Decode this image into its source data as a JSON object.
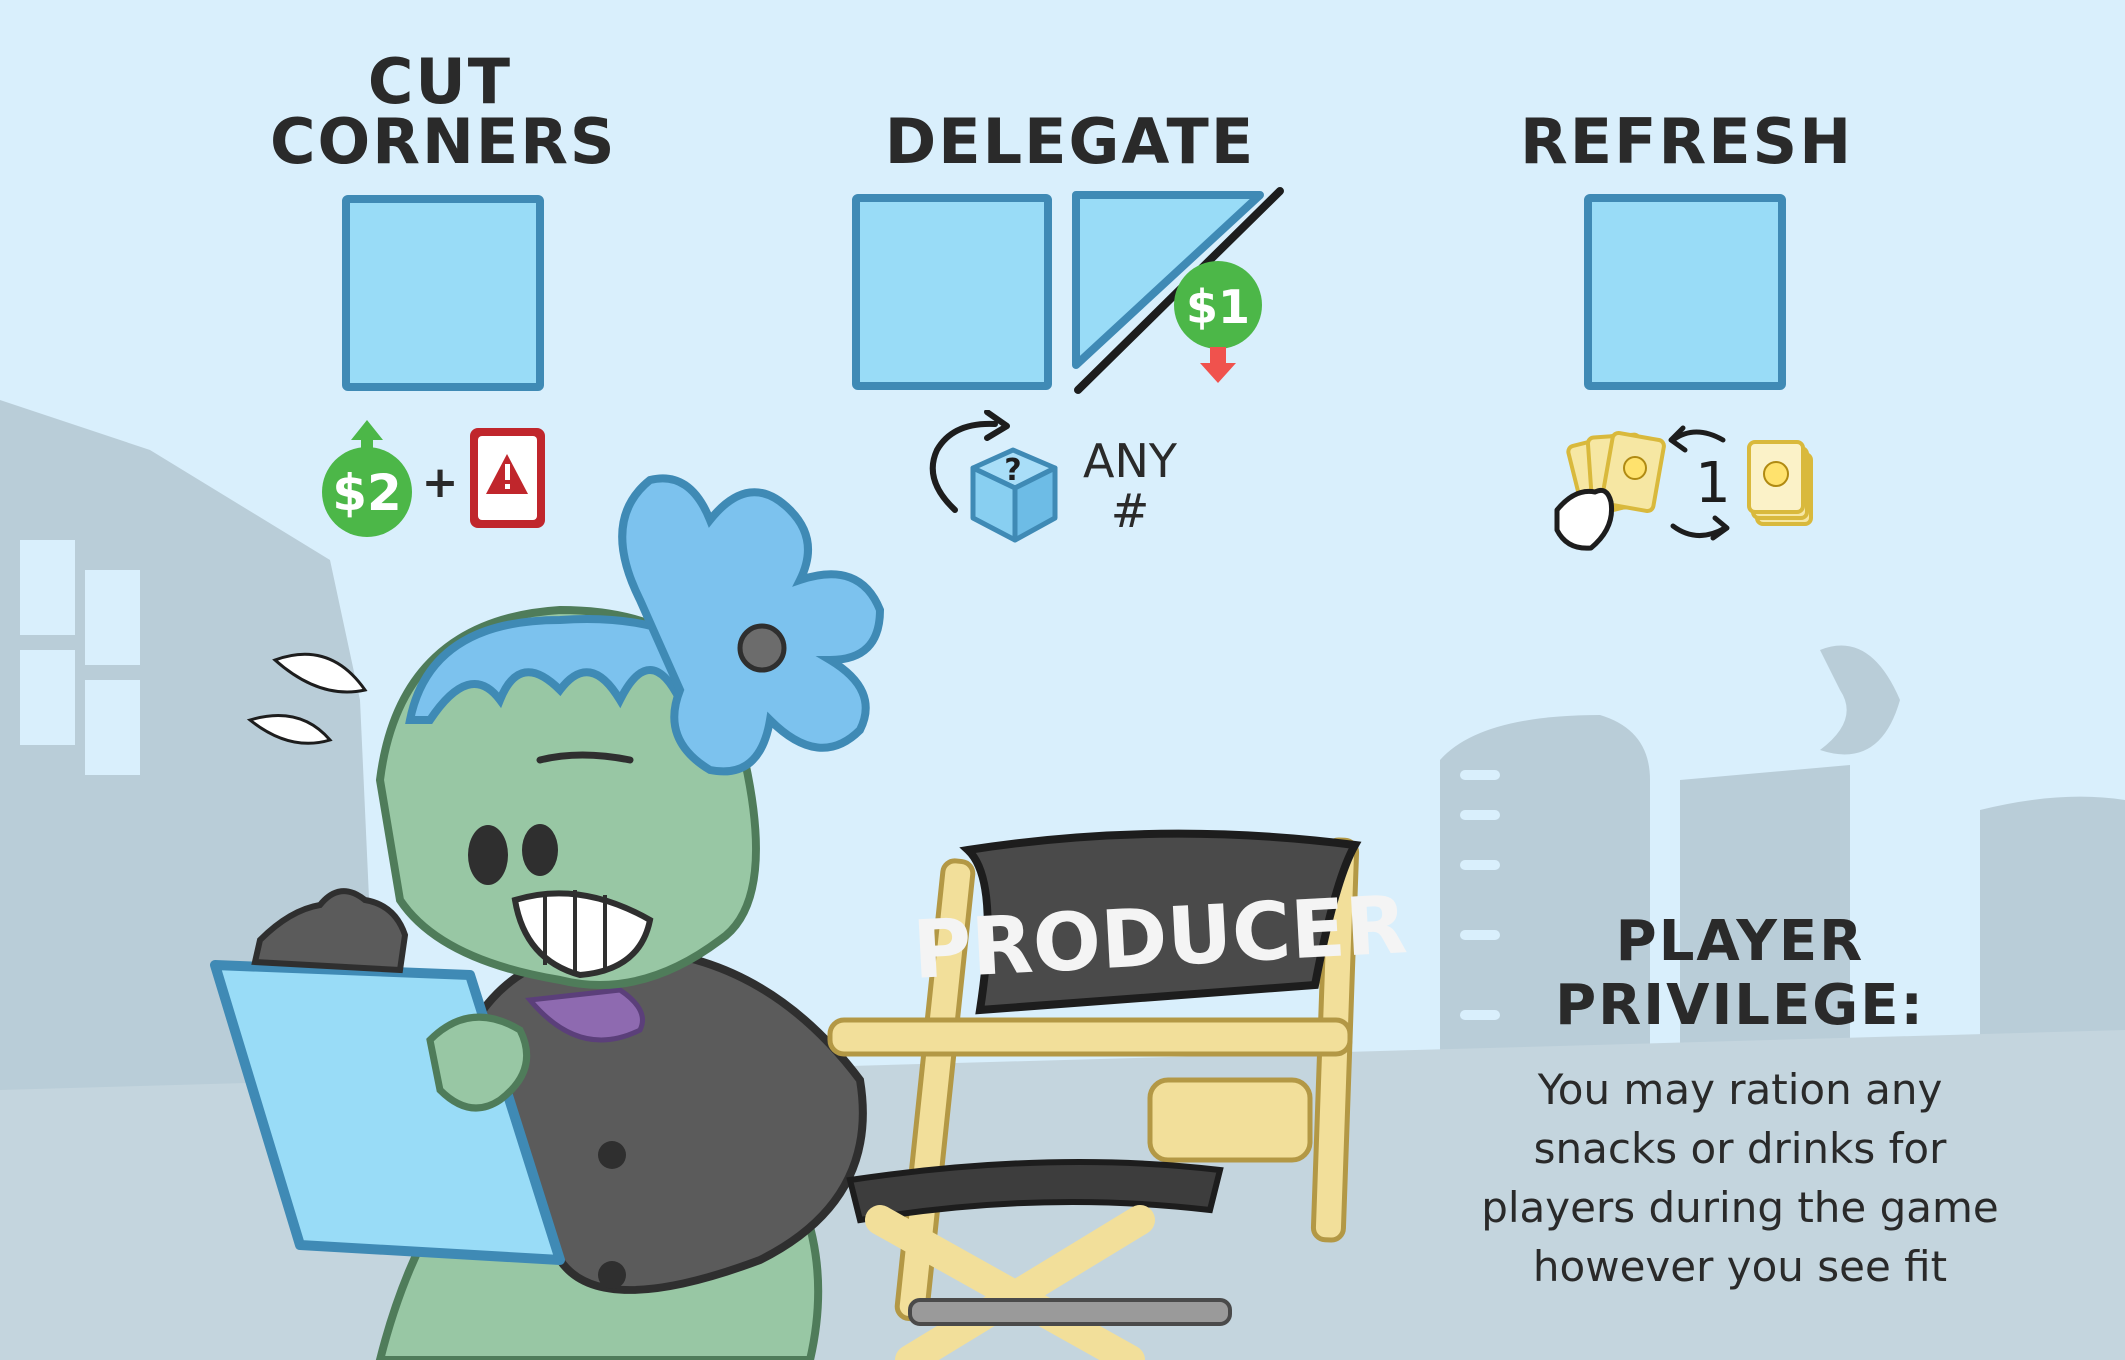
{
  "actions": [
    {
      "title_line1": "CUT",
      "title_line2": "CORNERS",
      "cost_coin": "$2",
      "plus": "+",
      "icons": [
        "green-coin-up-icon",
        "warning-card-icon"
      ]
    },
    {
      "title_line1": "",
      "title_line2": "DELEGATE",
      "discount_coin": "$1",
      "icon_text_line1": "ANY",
      "icon_text_line2": "#",
      "icons": [
        "reroll-arrow-icon",
        "mystery-die-icon",
        "red-coin-down-icon"
      ]
    },
    {
      "title_line1": "",
      "title_line2": "REFRESH",
      "swap_count": "1",
      "icons": [
        "hand-of-idea-cards-icon",
        "swap-arrows-icon",
        "idea-deck-icon"
      ]
    }
  ],
  "chair": {
    "label": "PRODUCER"
  },
  "player_privilege": {
    "title_line1": "PLAYER",
    "title_line2": "PRIVILEGE:",
    "text_lines": [
      "You may ration any",
      "snacks or drinks for",
      "players during the game",
      "however you see fit"
    ]
  },
  "colors": {
    "sky": "#d9effc",
    "slot_fill": "#99dcf7",
    "slot_border": "#3f8ab5",
    "coin_green": "#4cb748",
    "arrow_red": "#f0524d",
    "warning_red": "#c0262c",
    "city_silhouette": "#b9cdd8",
    "character_skin": "#98c7a4",
    "character_hair": "#7cc2ee"
  }
}
